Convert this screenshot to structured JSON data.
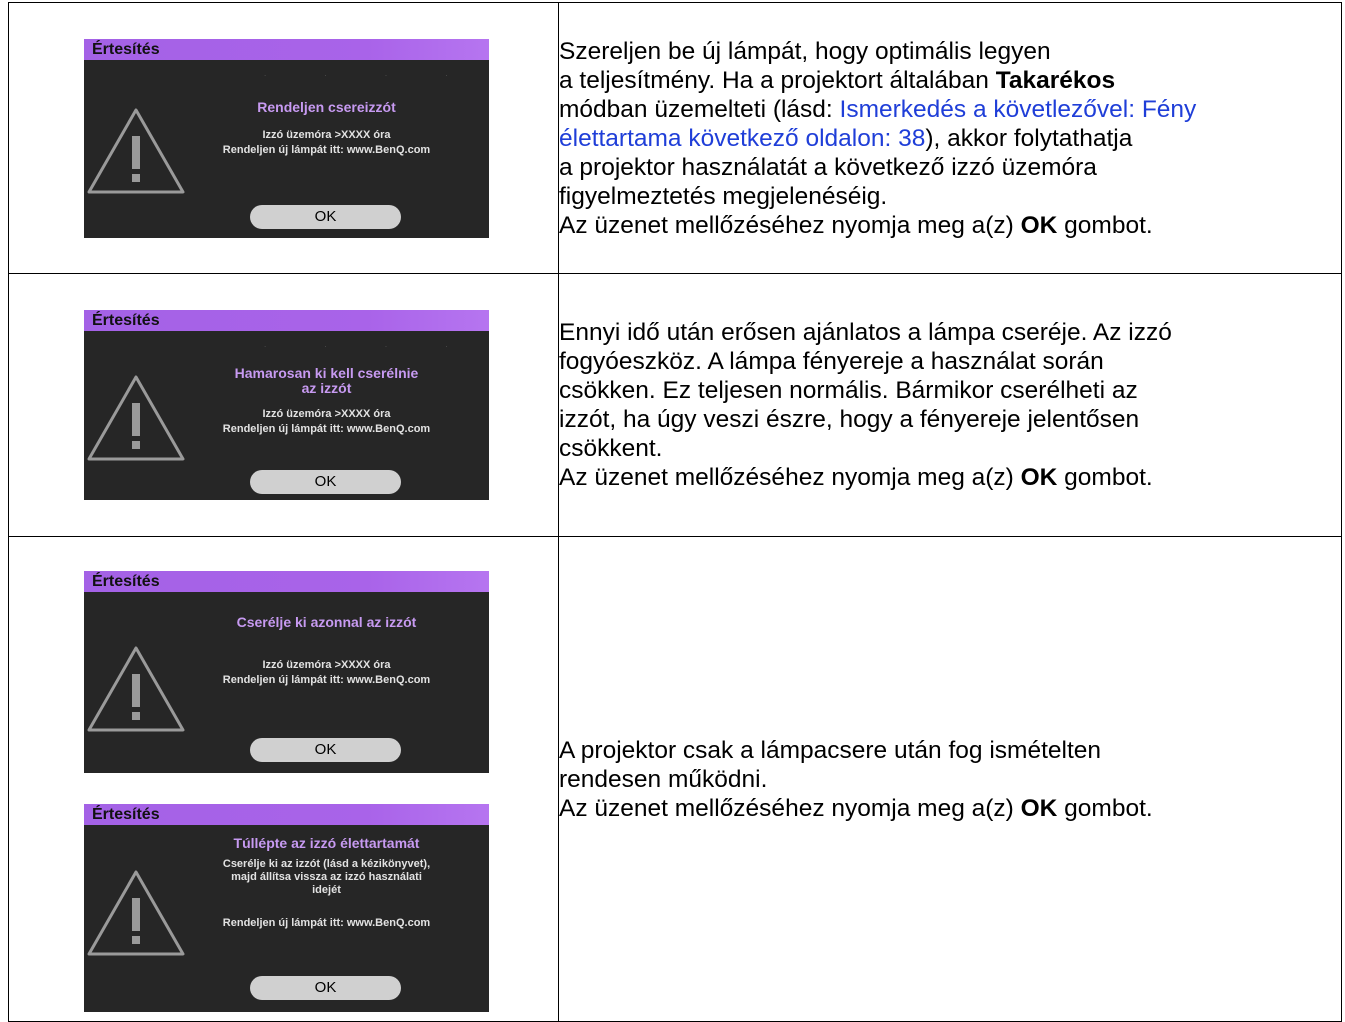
{
  "rows": [
    {
      "dialogs": [
        {
          "title": "Értesítés",
          "heading": "Rendeljen csereizzót",
          "body": [
            "Izzó üzemóra >XXXX óra",
            "Rendeljen új lámpát itt: www.BenQ.com"
          ],
          "button": "OK"
        }
      ],
      "text": {
        "l1": "Szereljen be új lámpát, hogy optimális legyen",
        "l2a": "a teljesítmény. Ha a projektort általában ",
        "l2b": "Takarékos",
        "l3a": "módban üzemelteti (lásd: ",
        "l3b": "Ismerkedés a követlezővel: Fény",
        "l4a": "élettartama következő oldalon: 38",
        "l4b": "), akkor folytathatja",
        "l5": "a projektor használatát a következő izzó üzemóra",
        "l6": "figyelmeztetés megjelenéséig.",
        "l7a": "Az üzenet mellőzéséhez nyomja meg a(z) ",
        "l7b": "OK",
        "l7c": " gombot."
      }
    },
    {
      "dialogs": [
        {
          "title": "Értesítés",
          "heading": [
            "Hamarosan ki kell cserélnie",
            "az izzót"
          ],
          "body": [
            "Izzó üzemóra >XXXX óra",
            "Rendeljen új lámpát itt: www.BenQ.com"
          ],
          "button": "OK"
        }
      ],
      "text": {
        "l1": "Ennyi idő után erősen ajánlatos a lámpa cseréje. Az izzó",
        "l2": "fogyóeszköz. A lámpa fényereje a használat során",
        "l3": "csökken. Ez teljesen normális. Bármikor cserélheti az",
        "l4": "izzót, ha úgy veszi észre, hogy a fényereje jelentősen",
        "l5": "csökkent.",
        "l6a": "Az üzenet mellőzéséhez nyomja meg a(z) ",
        "l6b": "OK",
        "l6c": " gombot."
      }
    },
    {
      "dialogs": [
        {
          "title": "Értesítés",
          "heading": "Cserélje ki azonnal az izzót",
          "body": [
            "Izzó üzemóra >XXXX óra",
            "Rendeljen új lámpát itt: www.BenQ.com"
          ],
          "button": "OK"
        },
        {
          "title": "Értesítés",
          "heading": "Túllépte az izzó élettartamát",
          "body": [
            "Cserélje ki az izzót (lásd a kézikönyvet),",
            "majd állítsa vissza az izzó használati",
            "idejét"
          ],
          "footer": "Rendeljen új lámpát itt: www.BenQ.com",
          "button": "OK"
        }
      ],
      "text": {
        "l1": "A projektor csak a lámpacsere után fog ismételten",
        "l2": "rendesen működni.",
        "l3a": "Az üzenet mellőzéséhez nyomja meg a(z) ",
        "l3b": "OK",
        "l3c": " gombot."
      }
    }
  ],
  "colors": {
    "dialog_bg": "#262626",
    "titlebar": "#a963e9",
    "heading": "#c79af1",
    "link": "#1f3ed8"
  },
  "icons": [
    "warning-triangle-icon"
  ]
}
